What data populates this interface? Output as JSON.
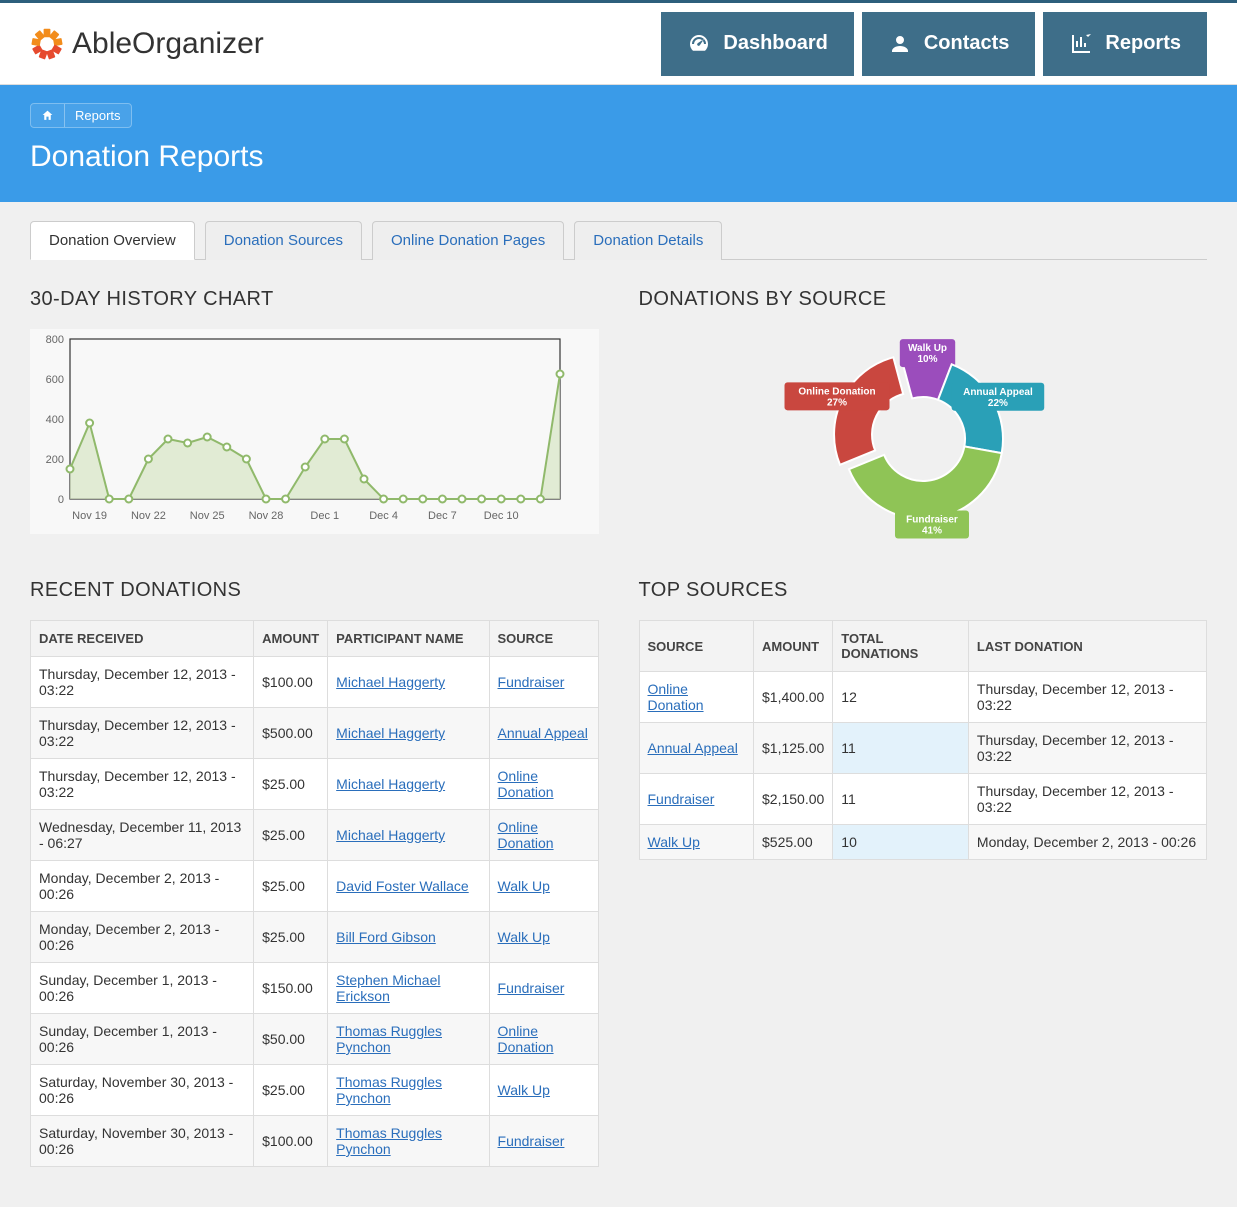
{
  "brand": "AbleOrganizer",
  "nav": {
    "dashboard": "Dashboard",
    "contacts": "Contacts",
    "reports": "Reports"
  },
  "breadcrumb": {
    "home_icon": "home-icon",
    "reports": "Reports"
  },
  "page_title": "Donation Reports",
  "tabs": [
    "Donation Overview",
    "Donation Sources",
    "Online Donation Pages",
    "Donation Details"
  ],
  "sections": {
    "history": "30-DAY HISTORY CHART",
    "by_source": "DONATIONS BY SOURCE",
    "recent": "RECENT DONATIONS",
    "top_sources": "TOP SOURCES"
  },
  "recent_headers": {
    "date": "DATE RECEIVED",
    "amount": "AMOUNT",
    "participant": "PARTICIPANT NAME",
    "source": "SOURCE"
  },
  "recent": [
    {
      "date": "Thursday, December 12, 2013 - 03:22",
      "amount": "$100.00",
      "participant": "Michael Haggerty",
      "source": "Fundraiser"
    },
    {
      "date": "Thursday, December 12, 2013 - 03:22",
      "amount": "$500.00",
      "participant": "Michael Haggerty",
      "source": "Annual Appeal"
    },
    {
      "date": "Thursday, December 12, 2013 - 03:22",
      "amount": "$25.00",
      "participant": "Michael Haggerty",
      "source": "Online Donation"
    },
    {
      "date": "Wednesday, December 11, 2013 - 06:27",
      "amount": "$25.00",
      "participant": "Michael Haggerty",
      "source": "Online Donation"
    },
    {
      "date": "Monday, December 2, 2013 - 00:26",
      "amount": "$25.00",
      "participant": "David Foster Wallace",
      "source": "Walk Up"
    },
    {
      "date": "Monday, December 2, 2013 - 00:26",
      "amount": "$25.00",
      "participant": "Bill Ford Gibson",
      "source": "Walk Up"
    },
    {
      "date": "Sunday, December 1, 2013 - 00:26",
      "amount": "$150.00",
      "participant": "Stephen Michael Erickson",
      "source": "Fundraiser"
    },
    {
      "date": "Sunday, December 1, 2013 - 00:26",
      "amount": "$50.00",
      "participant": "Thomas Ruggles Pynchon",
      "source": "Online Donation"
    },
    {
      "date": "Saturday, November 30, 2013 - 00:26",
      "amount": "$25.00",
      "participant": "Thomas Ruggles Pynchon",
      "source": "Walk Up"
    },
    {
      "date": "Saturday, November 30, 2013 - 00:26",
      "amount": "$100.00",
      "participant": "Thomas Ruggles Pynchon",
      "source": "Fundraiser"
    }
  ],
  "top_headers": {
    "source": "SOURCE",
    "amount": "AMOUNT",
    "total": "TOTAL DONATIONS",
    "last": "LAST DONATION"
  },
  "top": [
    {
      "source": "Online Donation",
      "amount": "$1,400.00",
      "total": "12",
      "last": "Thursday, December 12, 2013 - 03:22",
      "hl": false
    },
    {
      "source": "Annual Appeal",
      "amount": "$1,125.00",
      "total": "11",
      "last": "Thursday, December 12, 2013 - 03:22",
      "hl": true
    },
    {
      "source": "Fundraiser",
      "amount": "$2,150.00",
      "total": "11",
      "last": "Thursday, December 12, 2013 - 03:22",
      "hl": false
    },
    {
      "source": "Walk Up",
      "amount": "$525.00",
      "total": "10",
      "last": "Monday, December 2, 2013 - 00:26",
      "hl": true
    }
  ],
  "chart_data": {
    "line": {
      "type": "line",
      "title": "30-DAY HISTORY CHART",
      "ylim": [
        0,
        800
      ],
      "yticks": [
        0,
        200,
        400,
        600,
        800
      ],
      "xticks": [
        "Nov 19",
        "Nov 22",
        "Nov 25",
        "Nov 28",
        "Dec 1",
        "Dec 4",
        "Dec 7",
        "Dec 10"
      ],
      "x": [
        0,
        1,
        2,
        3,
        4,
        5,
        6,
        7,
        8,
        9,
        10,
        11,
        12,
        13,
        14,
        15,
        16,
        17,
        18,
        19,
        20,
        21,
        22,
        23,
        24,
        25
      ],
      "values": [
        150,
        380,
        0,
        0,
        200,
        300,
        280,
        310,
        260,
        200,
        0,
        0,
        160,
        300,
        300,
        100,
        0,
        0,
        0,
        0,
        0,
        0,
        0,
        0,
        0,
        625
      ],
      "color": "#90b96b",
      "fill": "#d7e6c4"
    },
    "donut": {
      "type": "pie",
      "title": "DONATIONS BY SOURCE",
      "series": [
        {
          "name": "Walk Up",
          "pct": 10,
          "color": "#9b4dbc",
          "label": "Walk Up\n10%"
        },
        {
          "name": "Annual Appeal",
          "pct": 22,
          "color": "#2aa0b7",
          "label": "Annual Appeal\n22%"
        },
        {
          "name": "Fundraiser",
          "pct": 41,
          "color": "#8fc456",
          "label": "Fundraiser\n41%"
        },
        {
          "name": "Online Donation",
          "pct": 27,
          "color": "#c9473f",
          "label": "Online Donation\n27%",
          "pulled": true
        }
      ]
    }
  }
}
